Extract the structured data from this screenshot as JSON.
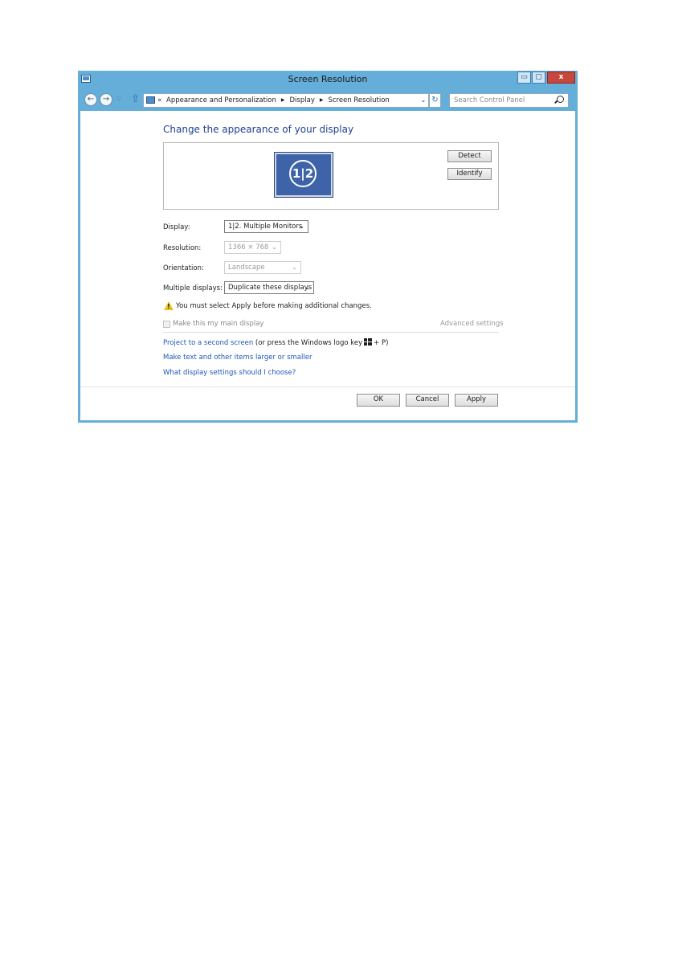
{
  "window": {
    "title": "Screen Resolution",
    "controls": {
      "minimize": "▭",
      "maximize": "▢",
      "close": "x"
    }
  },
  "address_bar": {
    "breadcrumb_prefix": "«",
    "breadcrumbs": [
      "Appearance and Personalization",
      "Display",
      "Screen Resolution"
    ],
    "search_placeholder": "Search Control Panel"
  },
  "main": {
    "heading": "Change the appearance of your display",
    "monitor_label": "1|2",
    "detect_label": "Detect",
    "identify_label": "Identify",
    "display": {
      "label": "Display:",
      "value": "1|2. Multiple Monitors"
    },
    "resolution": {
      "label": "Resolution:",
      "value": "1366 × 768"
    },
    "orientation": {
      "label": "Orientation:",
      "value": "Landscape"
    },
    "multiple_displays": {
      "label": "Multiple displays:",
      "value": "Duplicate these displays"
    },
    "warning": "You must select Apply before making additional changes.",
    "main_display_checkbox": "Make this my main display",
    "advanced_settings": "Advanced settings",
    "project_link": "Project to a second screen",
    "project_hint_before": "(or press the Windows logo key",
    "project_hint_after": "+ P)",
    "text_size_link": "Make text and other items larger or smaller",
    "help_link": "What display settings should I choose?"
  },
  "footer": {
    "ok": "OK",
    "cancel": "Cancel",
    "apply": "Apply"
  },
  "colors": {
    "frame": "#64aed9",
    "heading": "#1c3f94",
    "link": "#1f55b6",
    "monitor": "#3f63a8",
    "close_button": "#c7473d",
    "warning": "#e8c21d"
  },
  "icons": [
    "app-icon",
    "back-arrow-icon",
    "forward-arrow-icon",
    "up-arrow-icon",
    "control-panel-icon",
    "refresh-icon",
    "search-icon",
    "warning-icon",
    "windows-logo-icon",
    "chevron-down-icon"
  ]
}
